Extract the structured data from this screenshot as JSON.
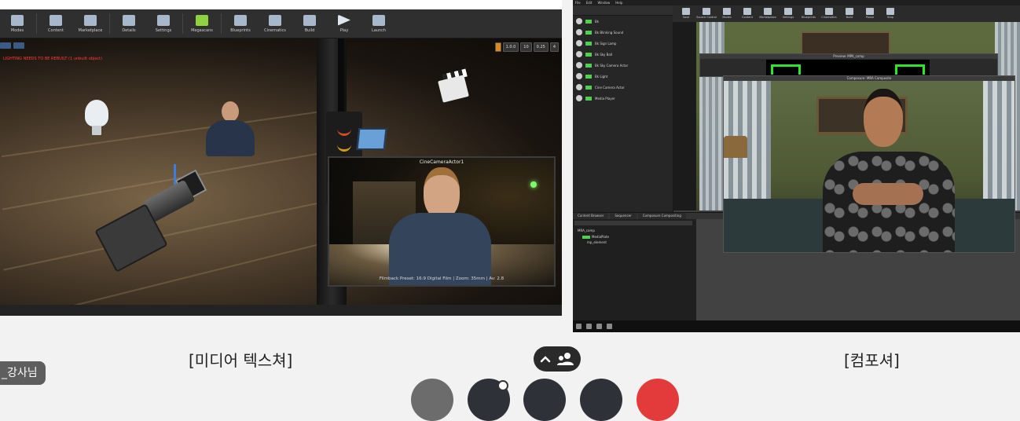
{
  "left_share": {
    "toolbar_items": [
      "Modes",
      "Content",
      "Marketplace",
      "Details",
      "Settings",
      "Megascans",
      "Blueprints",
      "Cinematics",
      "Build",
      "Play",
      "Launch"
    ],
    "viewport_warning": "LIGHTING NEEDS TO BE REBUILT (1 unbuilt object)",
    "viewport_stats": [
      "1.0.0",
      "10",
      "0.25",
      "4"
    ],
    "pip_title": "CineCameraActor1",
    "pip_caption": "Filmback Preset: 16:9 Digital Film | Zoom: 35mm | Av: 2.8",
    "caption": "[미디어 텍스쳐]"
  },
  "right_share": {
    "menubar": [
      "File",
      "Edit",
      "Window",
      "Help"
    ],
    "toolbar_items": [
      "Save",
      "Source Control",
      "Modes",
      "Content",
      "Marketplace",
      "Settings",
      "Blueprints",
      "Cinematics",
      "Build",
      "Pause",
      "Stop"
    ],
    "left_panel_items": [
      "Bk",
      "Bk Blinking Sound",
      "Bk Sign Lamp",
      "Bk Sky Ball",
      "Bk Sky Camera Actor",
      "Bk Light",
      "Cine Camera Actor",
      "Media Player"
    ],
    "panel_small_title": "Preview: MPA_comp",
    "panel_large_title": "Composure: MRA Composite",
    "bottom_tabs": [
      "Content Browser",
      "Sequencer",
      "Composure Compositing"
    ],
    "tree_items": [
      "MRA_comp",
      "MediaPlate",
      "mp_element"
    ],
    "caption": "[컴포셔]"
  },
  "participant": {
    "name": "_강사님"
  },
  "controls": {
    "view_toggle_icon": "chevron-up-icon",
    "people_icon": "people-icon",
    "accent_end_call": "#e33b3b"
  }
}
